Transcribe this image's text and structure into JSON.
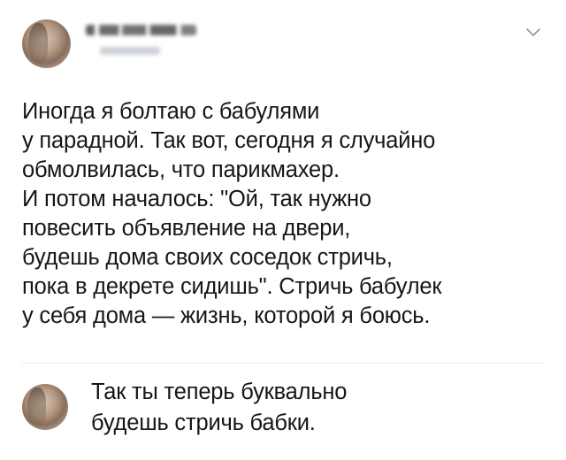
{
  "tweet": {
    "lines": [
      "Иногда я болтаю с бабулями",
      "у парадной. Так вот, сегодня я случайно",
      "обмолвилась, что парикмахер.",
      "И потом началось: \"Ой, так нужно",
      "повесить объявление на двери,",
      "будешь дома своих соседок стричь,",
      "пока в декрете сидишь\". Стричь бабулек",
      "у себя дома — жизнь, которой я боюсь."
    ],
    "menu_icon": "chevron-down-icon"
  },
  "reply": {
    "lines": [
      "Так ты теперь буквально",
      "будешь стричь бабки."
    ]
  },
  "colors": {
    "text": "#14171a",
    "divider": "#e1e8ed",
    "chevron": "#8899a6"
  }
}
